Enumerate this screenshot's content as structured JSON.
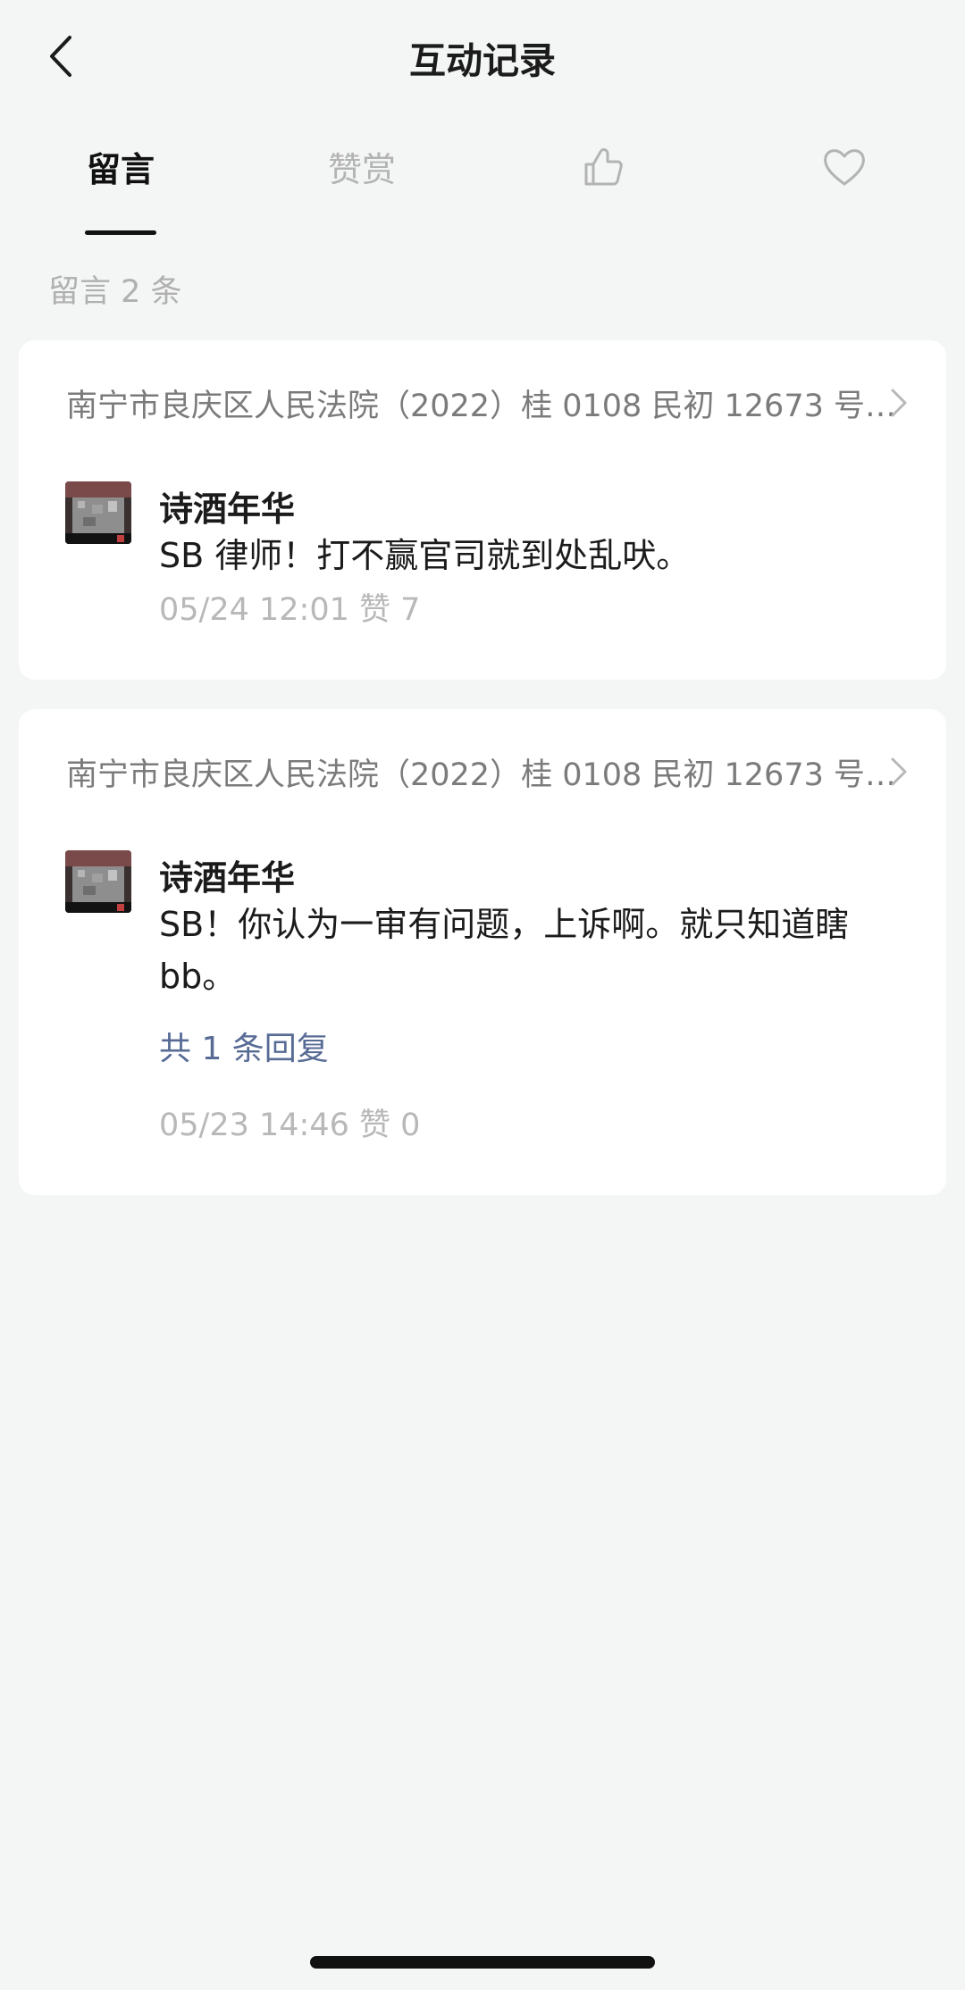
{
  "nav": {
    "title": "互动记录",
    "back_icon": "chevron-left-icon"
  },
  "tabs": [
    {
      "label": "留言",
      "active": true
    },
    {
      "label": "赞赏",
      "active": false
    },
    {
      "icon": "thumbs-up-icon",
      "active": false
    },
    {
      "icon": "heart-icon",
      "active": false
    }
  ],
  "count_text": "留言 2 条",
  "comments": [
    {
      "article": "南宁市良庆区人民法院（2022）桂 0108 民初 12673 号…",
      "author": "诗酒年华",
      "text": "SB 律师！打不赢官司就到处乱吠。",
      "meta": "05/24 12:01 赞 7"
    },
    {
      "article": "南宁市良庆区人民法院（2022）桂 0108 民初 12673 号…",
      "author": "诗酒年华",
      "text": "SB！你认为一审有问题，上诉啊。就只知道瞎 bb。",
      "reply": "共 1 条回复",
      "meta": "05/23 14:46 赞 0"
    }
  ],
  "colors": {
    "background": "#f4f5f5",
    "card": "#ffffff",
    "link": "#576b95",
    "muted": "#b8b8b8"
  }
}
